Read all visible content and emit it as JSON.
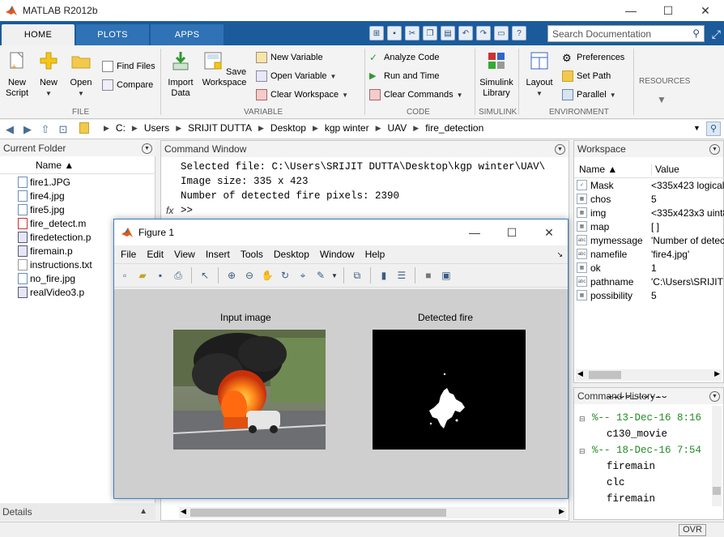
{
  "window": {
    "title": "MATLAB R2012b",
    "minimize": "—",
    "maximize": "☐",
    "close": "✕"
  },
  "tabs": [
    {
      "label": "HOME"
    },
    {
      "label": "PLOTS"
    },
    {
      "label": "APPS"
    }
  ],
  "search": {
    "placeholder": "Search Documentation"
  },
  "ribbon": {
    "file": {
      "new_script": "New\nScript",
      "new": "New",
      "open": "Open",
      "find_files": "Find Files",
      "compare": "Compare",
      "label": "FILE"
    },
    "variable": {
      "import_data": "Import\nData",
      "save_workspace": "Save\nWorkspace",
      "new_variable": "New Variable",
      "open_variable": "Open Variable",
      "clear_workspace": "Clear Workspace",
      "label": "VARIABLE"
    },
    "code": {
      "analyze_code": "Analyze Code",
      "run_and_time": "Run and Time",
      "clear_commands": "Clear Commands",
      "label": "CODE"
    },
    "simulink": {
      "simulink_library": "Simulink\nLibrary",
      "label": "SIMULINK"
    },
    "environment": {
      "layout": "Layout",
      "preferences": "Preferences",
      "set_path": "Set Path",
      "parallel": "Parallel",
      "label": "ENVIRONMENT"
    },
    "resources": {
      "label": "RESOURCES"
    }
  },
  "address": {
    "crumbs": [
      "C:",
      "Users",
      "SRIJIT DUTTA",
      "Desktop",
      "kgp winter",
      "UAV",
      "fire_detection"
    ]
  },
  "current_folder": {
    "title": "Current Folder",
    "column": "Name ▲",
    "files": [
      {
        "name": "fire1.JPG",
        "type": "image"
      },
      {
        "name": "fire4.jpg",
        "type": "image"
      },
      {
        "name": "fire5.jpg",
        "type": "image"
      },
      {
        "name": "fire_detect.m",
        "type": "script"
      },
      {
        "name": "firedetection.p",
        "type": "pcode"
      },
      {
        "name": "firemain.p",
        "type": "pcode"
      },
      {
        "name": "instructions.txt",
        "type": "text"
      },
      {
        "name": "no_fire.jpg",
        "type": "image"
      },
      {
        "name": "realVideo3.p",
        "type": "pcode"
      }
    ],
    "details": "Details"
  },
  "command_window": {
    "title": "Command Window",
    "lines": [
      "Selected file: C:\\Users\\SRIJIT DUTTA\\Desktop\\kgp winter\\UAV\\",
      "Image size: 335 x 423",
      "Number of detected fire pixels: 2390"
    ],
    "fx": "fx",
    "prompt": ">>"
  },
  "workspace": {
    "title": "Workspace",
    "col_name": "Name ▲",
    "col_value": "Value",
    "rows": [
      {
        "name": "Mask",
        "value": "<335x423 logical",
        "icon": "✓"
      },
      {
        "name": "chos",
        "value": "5",
        "icon": "▦"
      },
      {
        "name": "img",
        "value": "<335x423x3 uint8",
        "icon": "▦"
      },
      {
        "name": "map",
        "value": "[ ]",
        "icon": "▦"
      },
      {
        "name": "mymessage",
        "value": "'Number of detec",
        "icon": "abc"
      },
      {
        "name": "namefile",
        "value": "'fire4.jpg'",
        "icon": "abc"
      },
      {
        "name": "ok",
        "value": "1",
        "icon": "▦"
      },
      {
        "name": "pathname",
        "value": "'C:\\Users\\SRIJIT D",
        "icon": "abc"
      },
      {
        "name": "possibility",
        "value": "5",
        "icon": "▦"
      }
    ]
  },
  "command_history": {
    "title": "Command History",
    "cut_line": "c130_movie",
    "lines": [
      {
        "text": "%-- 13-Dec-16 8:16",
        "kind": "header"
      },
      {
        "text": "c130_movie",
        "kind": "cmd"
      },
      {
        "text": "%-- 18-Dec-16 7:54",
        "kind": "header"
      },
      {
        "text": "firemain",
        "kind": "cmd"
      },
      {
        "text": "clc",
        "kind": "cmd"
      },
      {
        "text": "firemain",
        "kind": "cmd"
      }
    ]
  },
  "figure": {
    "title": "Figure 1",
    "menu": [
      "File",
      "Edit",
      "View",
      "Insert",
      "Tools",
      "Desktop",
      "Window",
      "Help"
    ],
    "axes": [
      {
        "caption": "Input image"
      },
      {
        "caption": "Detected fire"
      }
    ]
  },
  "status": {
    "ovr": "OVR"
  },
  "colors": {
    "ribbon_blue": "#1b5b9c",
    "history_green": "#228b22"
  }
}
